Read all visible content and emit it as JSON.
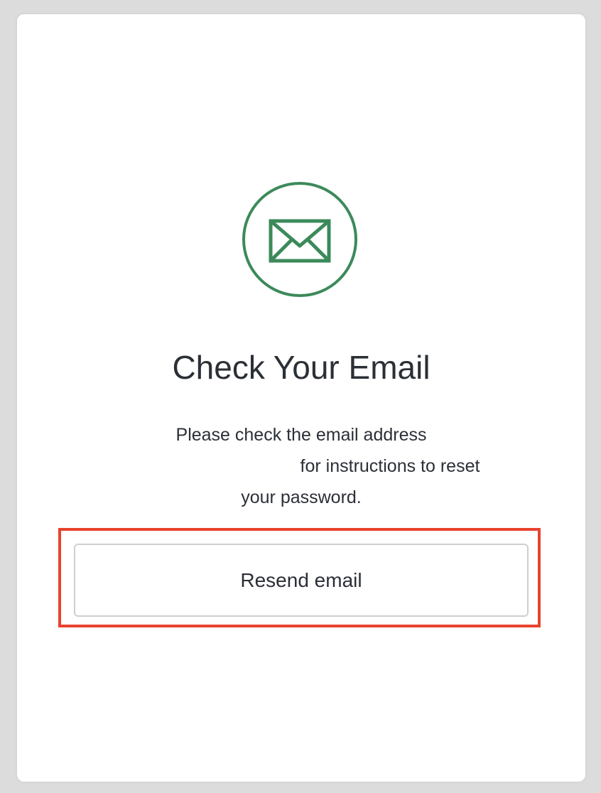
{
  "icon": {
    "name": "envelope-icon",
    "color": "#3c8a5a"
  },
  "title": "Check Your Email",
  "message": {
    "line1": "Please check the email address",
    "line2": "for instructions to reset",
    "line3": "your password."
  },
  "resend_button": {
    "label": "Resend email"
  },
  "colors": {
    "accent": "#3c8a5a",
    "highlight": "#e8432e",
    "text": "#2b2f36",
    "background": "#dcdcdc"
  }
}
